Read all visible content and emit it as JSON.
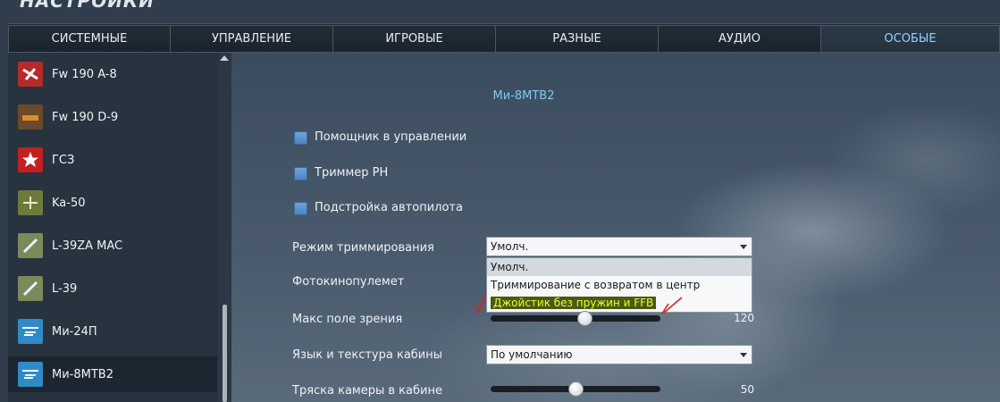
{
  "window": {
    "title": "НАСТРОЙКИ"
  },
  "tabs": [
    {
      "label": "СИСТЕМНЫЕ"
    },
    {
      "label": "УПРАВЛЕНИЕ"
    },
    {
      "label": "ИГРОВЫЕ"
    },
    {
      "label": "РАЗНЫЕ"
    },
    {
      "label": "АУДИО"
    },
    {
      "label": "ОСОБЫЕ"
    }
  ],
  "sidebar": {
    "items": [
      {
        "label": "Fw 190 A-8"
      },
      {
        "label": "Fw 190 D-9"
      },
      {
        "label": "ГСЗ"
      },
      {
        "label": "Ka-50"
      },
      {
        "label": "L-39ZA MAC"
      },
      {
        "label": "L-39"
      },
      {
        "label": "Ми-24П"
      },
      {
        "label": "Ми-8МТВ2"
      }
    ]
  },
  "content": {
    "section_title": "Ми-8МТВ2",
    "checkboxes": [
      {
        "label": "Помощник в управлении"
      },
      {
        "label": "Триммер РН"
      },
      {
        "label": "Подстройка автопилота"
      }
    ],
    "trim_mode": {
      "label": "Режим триммирования",
      "value": "Умолч.",
      "options": [
        "Умолч.",
        "Триммирование с возвратом в центр",
        "Джойстик без пружин и FFB"
      ]
    },
    "gun_camera": {
      "label": "Фотокинопулемет"
    },
    "max_fov": {
      "label": "Макс поле зрения",
      "value": "120",
      "fraction": 0.55
    },
    "cockpit_lang": {
      "label": "Язык и текстура кабины",
      "value": "По умолчанию"
    },
    "camera_shake": {
      "label": "Тряска камеры в кабине",
      "value": "50",
      "fraction": 0.5
    }
  },
  "colors": {
    "accent": "#8fd3ff",
    "highlight_text": "#e8ff2a",
    "annotation": "#e0201a"
  }
}
